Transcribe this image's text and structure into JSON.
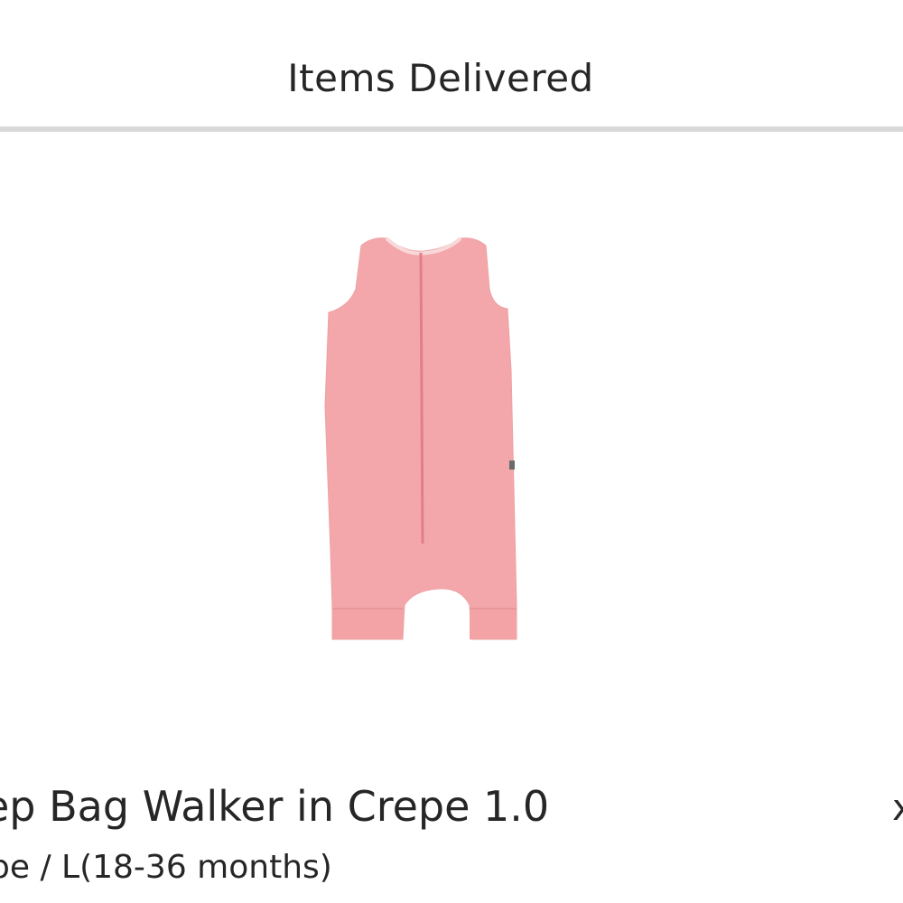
{
  "header": {
    "title": "Items Delivered"
  },
  "item": {
    "name": "ep Bag Walker in Crepe 1.0",
    "variant": "pe / L(18-36 months)",
    "quantity_marker": "x",
    "image_icon": "sleep-bag-walker-pink-image",
    "image_color": "#f4a7aa"
  }
}
